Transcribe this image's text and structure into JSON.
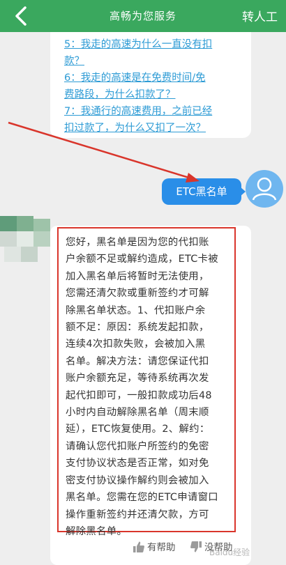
{
  "header": {
    "title": "高畅为您服务",
    "transfer_label": "转人工"
  },
  "faq": [
    {
      "line1": "5：我走的高速为什么一直没有扣",
      "line2": "款？"
    },
    {
      "line1": "6：我走的高速是在免费时间/免",
      "line2": "费路段，为什么扣款了？"
    },
    {
      "line1": "7：我通行的高速费用，之前已经",
      "line2": "扣过款了，为什么又扣了一次？"
    }
  ],
  "user_message": "ETC黑名单",
  "answer": {
    "lines": [
      "您好，黑名单是因为您的代扣账",
      "户余额不足或解约造成，ETC卡被",
      "加入黑名单后将暂时无法使用，",
      "您需还清欠款或重新签约才可解",
      "除黑名单状态。1、代扣账户余",
      "额不足：原因：系统发起扣款，",
      "连续4次扣款失败，会被加入黑",
      "名单。解决方法：请您保证代扣",
      "账户余额充足，等待系统再次发",
      "起代扣即可，一般扣款成功后48",
      "小时内自动解除黑名单（周末顺",
      "延），ETC恢复使用。2、解约：",
      "请确认您代扣账户所签约的免密",
      "支付协议状态是否正常，如对免",
      "密支付协议操作解约则会被加入",
      "黑名单。您需在您的ETC申请窗口",
      "操作重新签约并还清欠款，方可",
      "解除黑名单。"
    ]
  },
  "feedback": {
    "helpful_label": "有帮助",
    "unhelpful_label": "没帮助"
  },
  "watermark": "Baidu经验",
  "colors": {
    "header_bg": "#3aa85e",
    "link": "#2d9bd5",
    "user_bubble": "#2a8ee8",
    "annotation_red": "#d9352b"
  }
}
